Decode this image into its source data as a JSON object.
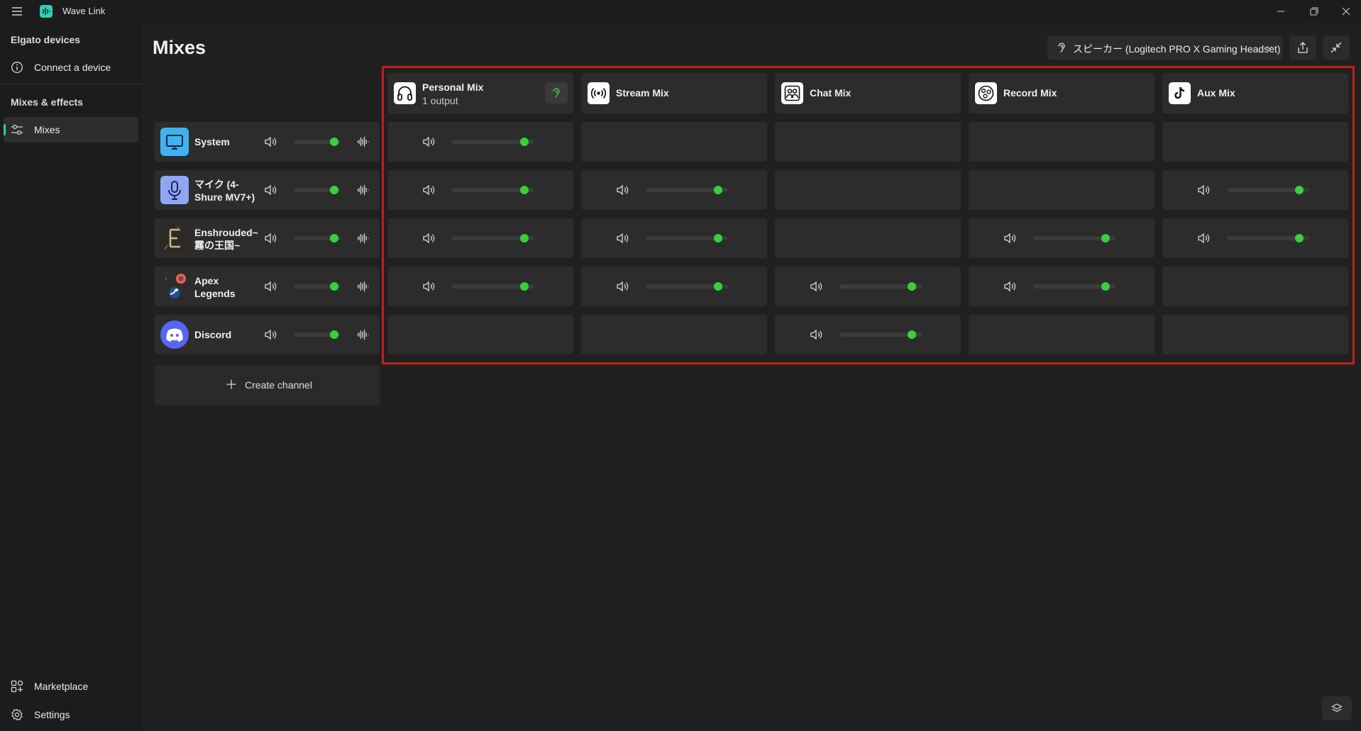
{
  "app": {
    "title": "Wave Link"
  },
  "sidebar": {
    "section_devices": "Elgato devices",
    "connect_device": "Connect a device",
    "section_mixes": "Mixes & effects",
    "mixes": "Mixes",
    "marketplace": "Marketplace",
    "settings": "Settings"
  },
  "header": {
    "page_title": "Mixes",
    "output_device": "スピーカー (Logitech PRO X Gaming Headset)"
  },
  "mixes": [
    {
      "name": "Personal Mix",
      "sub": "1 output",
      "icon": "headphones-icon"
    },
    {
      "name": "Stream Mix",
      "sub": "",
      "icon": "broadcast-icon"
    },
    {
      "name": "Chat Mix",
      "sub": "",
      "icon": "people-icon"
    },
    {
      "name": "Record Mix",
      "sub": "",
      "icon": "obs-icon"
    },
    {
      "name": "Aux Mix",
      "sub": "",
      "icon": "tiktok-icon"
    }
  ],
  "channels": [
    {
      "name": "System",
      "name2": "",
      "icon": "monitor-icon",
      "level": 0.9,
      "routing": [
        0.9,
        null,
        null,
        null,
        null
      ]
    },
    {
      "name": "マイク (4-",
      "name2": "Shure MV7+)",
      "icon": "microphone-icon",
      "level": 0.9,
      "routing": [
        0.9,
        0.9,
        null,
        null,
        0.9
      ]
    },
    {
      "name": "Enshrouded~",
      "name2": "霧の王国~",
      "icon": "enshrouded-game-icon",
      "level": 0.9,
      "routing": [
        0.9,
        0.9,
        null,
        0.9,
        0.9
      ]
    },
    {
      "name": "Apex",
      "name2": "Legends",
      "icon": "apex-legends-icon",
      "level": 0.9,
      "routing": [
        0.9,
        0.9,
        0.9,
        0.9,
        null
      ]
    },
    {
      "name": "Discord",
      "name2": "",
      "icon": "discord-icon",
      "level": 0.9,
      "routing": [
        null,
        null,
        0.9,
        null,
        null
      ]
    }
  ],
  "create_channel": "Create channel",
  "colors": {
    "accent": "#38d13a",
    "highlight": "#c0201a",
    "system_icon": "#3fb2f0",
    "mic_icon": "#8da7f5",
    "discord_icon": "#5865f2"
  }
}
